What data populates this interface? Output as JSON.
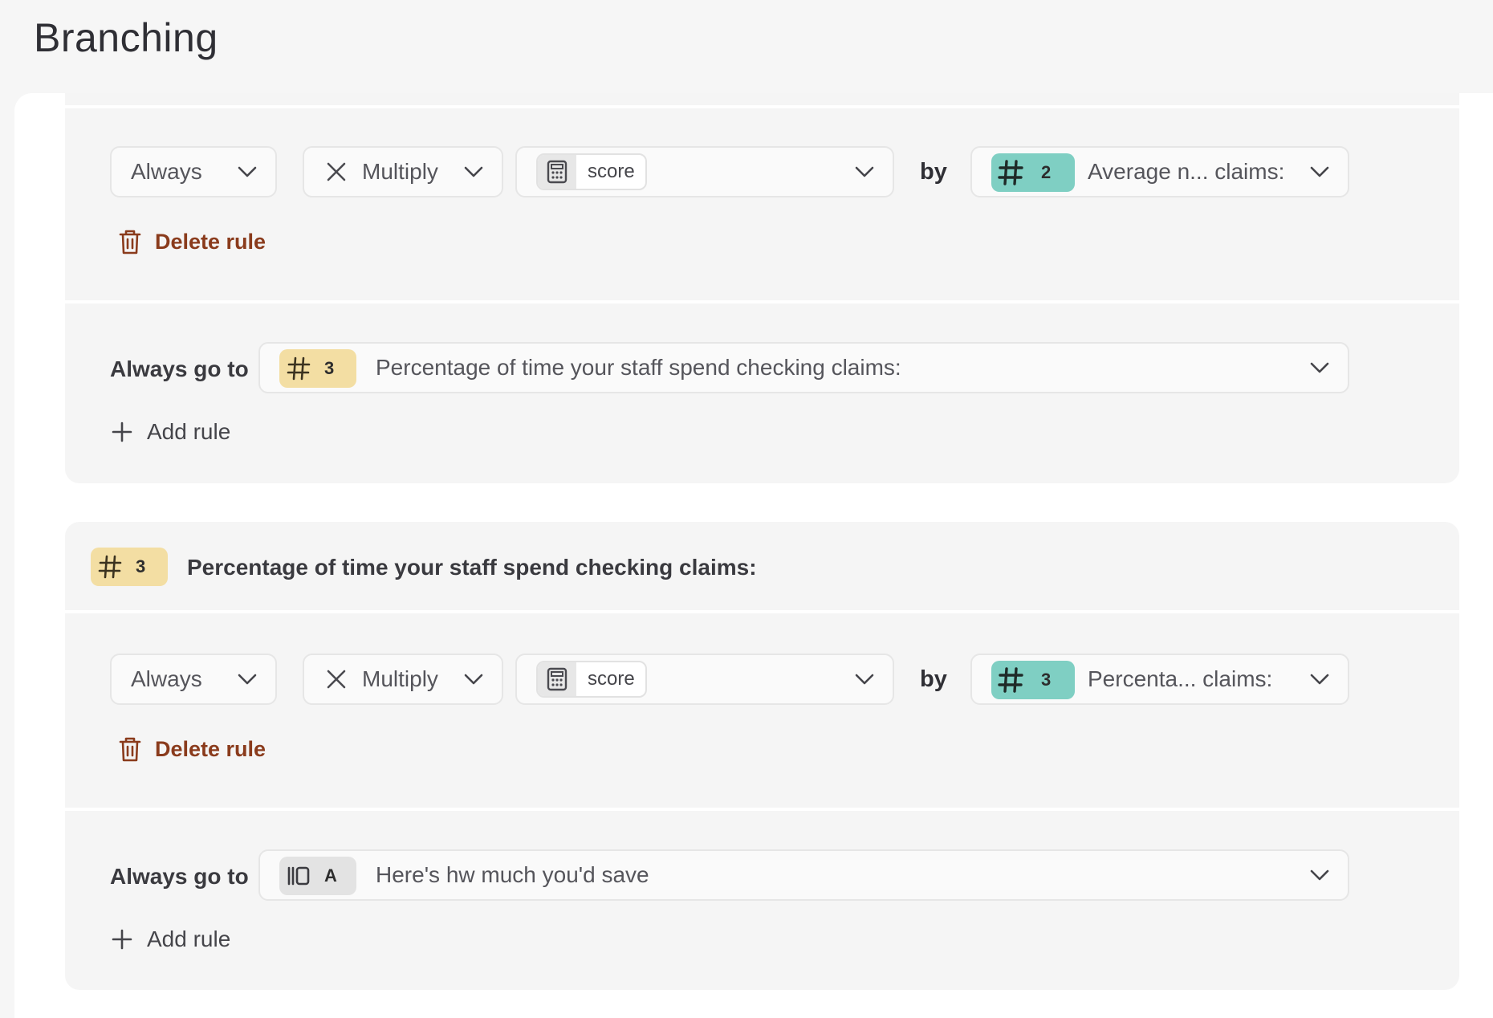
{
  "page": {
    "title": "Branching"
  },
  "rule_blocks": [
    {
      "rule": {
        "condition": "Always",
        "operation": "Multiply",
        "variable": "score",
        "by_label": "by",
        "operand_number": "2",
        "operand_label": "Average n... claims:"
      },
      "delete_label": "Delete rule",
      "go_to": {
        "label": "Always go to",
        "target_number": "3",
        "target_label": "Percentage of time your staff spend checking claims:"
      },
      "add_rule_label": "Add rule"
    },
    {
      "header": {
        "number": "3",
        "title": "Percentage of time your staff spend checking claims:"
      },
      "rule": {
        "condition": "Always",
        "operation": "Multiply",
        "variable": "score",
        "by_label": "by",
        "operand_number": "3",
        "operand_label": "Percenta... claims:"
      },
      "delete_label": "Delete rule",
      "go_to": {
        "label": "Always go to",
        "target_number": "A",
        "target_label": "Here's hw much you'd save"
      },
      "add_rule_label": "Add rule"
    }
  ],
  "colors": {
    "number_badge": "#7fcfc3",
    "question_badge": "#f3dea3",
    "statement_badge": "#e3e3e3",
    "delete": "#8a3b1c"
  },
  "icons": {
    "condition_chevron": "chevron-down-icon",
    "operation": "multiply-icon",
    "variable": "calculator-icon",
    "number_question": "hash-icon",
    "statement": "statement-icon",
    "delete": "trash-icon",
    "add": "plus-icon"
  }
}
